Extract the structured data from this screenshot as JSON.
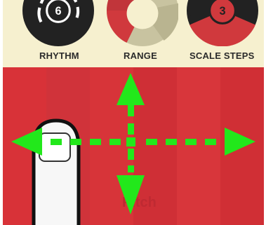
{
  "knobs": [
    {
      "label": "RHYTHM",
      "value": "6"
    },
    {
      "label": "RANGE",
      "value": ""
    },
    {
      "label": "SCALE STEPS",
      "value": "3"
    }
  ],
  "pad": {
    "label": "Pitch"
  },
  "colors": {
    "background": "#f6f0cf",
    "pad_red": "#d32f37",
    "knob_dark": "#222222",
    "knob_red": "#d0393d",
    "range_olive": "#c8c3a0",
    "gesture_green": "#22e81b"
  },
  "icons": {
    "finger": "finger-touch-icon",
    "gesture": "four-way-drag-arrows-icon"
  }
}
